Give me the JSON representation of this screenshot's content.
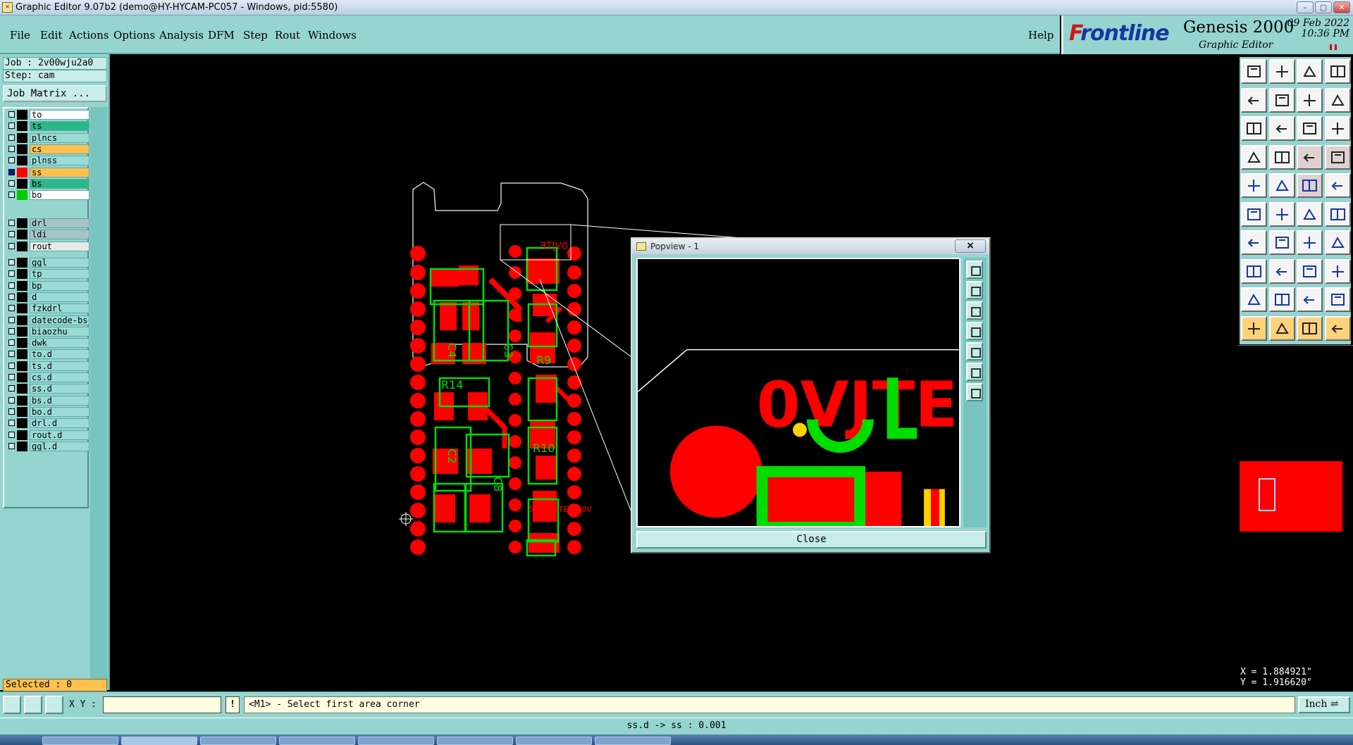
{
  "window": {
    "title": "Graphic Editor 9.07b2 (demo@HY-HYCAM-PC057 - Windows, pid:5580)"
  },
  "menu": {
    "items": [
      "File",
      "Edit",
      "Actions",
      "Options",
      "Analysis",
      "DFM",
      "Step",
      "Rout",
      "Windows"
    ],
    "help": "Help"
  },
  "brand": {
    "logo_prefix": "F",
    "logo_rest": "rontline",
    "product": "Genesis 2000",
    "subtitle": "Graphic Editor",
    "date": "09 Feb 2022",
    "time": "10:36 PM"
  },
  "job": {
    "job_label": "Job : 2v00wju2a0",
    "step_label": "Step: cam",
    "matrix_button": "Job Matrix ..."
  },
  "layers": [
    {
      "name": "to",
      "color": "#ffffff",
      "swatch": "#000000"
    },
    {
      "name": "ts",
      "color": "#2ab88a",
      "swatch": "#000000"
    },
    {
      "name": "plncs",
      "color": "#9adbd6",
      "swatch": "#000000"
    },
    {
      "name": "cs",
      "color": "#ffc04f",
      "swatch": "#000000"
    },
    {
      "name": "plnss",
      "color": "#9adbd6",
      "swatch": "#000000"
    },
    {
      "name": "ss",
      "color": "#ffc04f",
      "swatch": "#ff0000",
      "active": true
    },
    {
      "name": "bs",
      "color": "#2ab88a",
      "swatch": "#000000"
    },
    {
      "name": "bo",
      "color": "#ffffff",
      "swatch": "#00cc00"
    },
    {
      "name": "drl",
      "color": "#a8c4c8",
      "swatch": "#000000"
    },
    {
      "name": "ldi",
      "color": "#a8c4c8",
      "swatch": "#000000"
    },
    {
      "name": "rout",
      "color": "#e8e8e8",
      "swatch": "#000000"
    },
    {
      "name": "ggl",
      "color": "#9adbd6",
      "swatch": "#000000"
    },
    {
      "name": "tp",
      "color": "#9adbd6",
      "swatch": "#000000"
    },
    {
      "name": "bp",
      "color": "#9adbd6",
      "swatch": "#000000"
    },
    {
      "name": "d",
      "color": "#9adbd6",
      "swatch": "#000000"
    },
    {
      "name": "fzkdrl",
      "color": "#9adbd6",
      "swatch": "#000000"
    },
    {
      "name": "datecode-bs",
      "color": "#9adbd6",
      "swatch": "#000000"
    },
    {
      "name": "biaozhu",
      "color": "#9adbd6",
      "swatch": "#000000"
    },
    {
      "name": "dwk",
      "color": "#9adbd6",
      "swatch": "#000000"
    },
    {
      "name": "to.d",
      "color": "#9adbd6",
      "swatch": "#000000"
    },
    {
      "name": "ts.d",
      "color": "#9adbd6",
      "swatch": "#000000"
    },
    {
      "name": "cs.d",
      "color": "#9adbd6",
      "swatch": "#000000"
    },
    {
      "name": "ss.d",
      "color": "#9adbd6",
      "swatch": "#000000"
    },
    {
      "name": "bs.d",
      "color": "#9adbd6",
      "swatch": "#000000"
    },
    {
      "name": "bo.d",
      "color": "#9adbd6",
      "swatch": "#000000"
    },
    {
      "name": "drl.d",
      "color": "#9adbd6",
      "swatch": "#000000"
    },
    {
      "name": "rout.d",
      "color": "#9adbd6",
      "swatch": "#000000"
    },
    {
      "name": "ggl.d",
      "color": "#9adbd6",
      "swatch": "#000000"
    }
  ],
  "selected": "Selected : 0",
  "popview": {
    "title": "Popview - 1",
    "close_x": "×",
    "close_button": "Close"
  },
  "coords": {
    "x": "X = 1.884921\"",
    "y": "Y = 1.916620\""
  },
  "command": {
    "xy_label": "X Y :",
    "xy_value": "",
    "bang": "!",
    "prompt": "<M1> - Select first area corner",
    "units": "Inch ⇌"
  },
  "status": "ss.d -> ss : 0.001",
  "board_text": {
    "top_label": "0VJTE",
    "bottom_label": "STRESSTECH 0V",
    "refs": [
      "R13",
      "C4",
      "C3",
      "R14",
      "R9",
      "C2",
      "C8",
      "R10"
    ]
  },
  "tools": [
    "open-icon",
    "save-icon",
    "home-icon",
    "panels-icon",
    "prev-icon",
    "next-icon",
    "swap-icon",
    "redo-icon",
    "zoom-fit-icon",
    "zoom-home-icon",
    "scale-icon",
    "help-icon",
    "rotate-icon",
    "grid-icon",
    "snap-icon",
    "measure-icon",
    "camera-icon",
    "cut-icon",
    "ruler-icon",
    "pad-icon",
    "node-icon",
    "cross-icon",
    "line-icon",
    "arc-icon",
    "draw-icon",
    "slash-icon",
    "curve-icon",
    "align-icon",
    "shape-icon",
    "minus-icon",
    "bracket-icon",
    "group-icon",
    "poly-icon",
    "poly2-icon",
    "arc2-icon",
    "arc3-icon",
    "pointer-icon",
    "pointer2-icon",
    "pointer3-icon",
    "route-icon"
  ],
  "colors": {
    "panel": "#96d4d0",
    "copper": "#ff0000",
    "silk": "#00dd00",
    "overlap": "#ffd000"
  }
}
